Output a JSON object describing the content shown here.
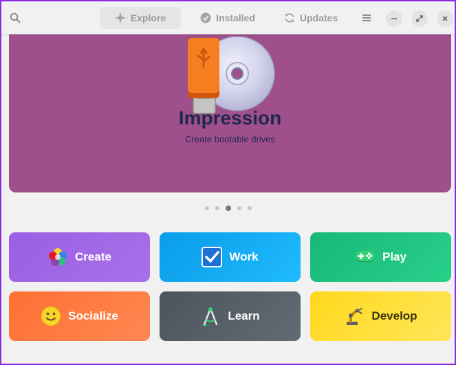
{
  "header": {
    "tabs": [
      {
        "label": "Explore",
        "icon": "explore-icon",
        "active": true
      },
      {
        "label": "Installed",
        "icon": "check-icon",
        "active": false
      },
      {
        "label": "Updates",
        "icon": "refresh-icon",
        "active": false
      }
    ],
    "search_icon": "search-icon",
    "menu_icon": "hamburger-menu-icon",
    "window_controls": [
      "minimize-icon",
      "maximize-icon",
      "close-icon"
    ]
  },
  "featured": {
    "title": "Impression",
    "subtitle": "Create bootable drives",
    "background_color": "#9f4f8c",
    "carousel": {
      "count": 5,
      "active_index": 2
    }
  },
  "categories": [
    {
      "label": "Create",
      "icon": "create-palette-icon",
      "color": "#a169e6"
    },
    {
      "label": "Work",
      "icon": "checkbox-icon",
      "color": "#14a8f0"
    },
    {
      "label": "Play",
      "icon": "gamepad-icon",
      "color": "#21c47e"
    },
    {
      "label": "Socialize",
      "icon": "smiley-icon",
      "color": "#ff7a42"
    },
    {
      "label": "Learn",
      "icon": "compass-icon",
      "color": "#545d66"
    },
    {
      "label": "Develop",
      "icon": "robot-arm-icon",
      "color": "#ffdc34"
    }
  ]
}
